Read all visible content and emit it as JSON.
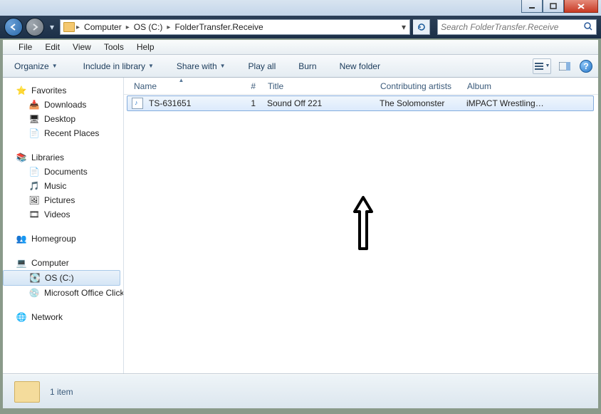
{
  "window": {
    "breadcrumbs": [
      "Computer",
      "OS (C:)",
      "FolderTransfer.Receive"
    ],
    "search_placeholder": "Search FolderTransfer.Receive"
  },
  "menubar": {
    "file": "File",
    "edit": "Edit",
    "view": "View",
    "tools": "Tools",
    "help": "Help"
  },
  "toolbar": {
    "organize": "Organize",
    "include": "Include in library",
    "share": "Share with",
    "playall": "Play all",
    "burn": "Burn",
    "newfolder": "New folder"
  },
  "columns": {
    "name": "Name",
    "num": "#",
    "title": "Title",
    "artists": "Contributing artists",
    "album": "Album"
  },
  "rows": [
    {
      "name": "TS-631651",
      "num": "1",
      "title": "Sound Off 221",
      "artists": "The Solomonster",
      "album": "iMPACT Wrestling G..."
    }
  ],
  "nav": {
    "favorites": "Favorites",
    "downloads": "Downloads",
    "desktop": "Desktop",
    "recent": "Recent Places",
    "libraries": "Libraries",
    "documents": "Documents",
    "music": "Music",
    "pictures": "Pictures",
    "videos": "Videos",
    "homegroup": "Homegroup",
    "computer": "Computer",
    "osc": "OS (C:)",
    "msoffice": "Microsoft Office Click-to-Run",
    "network": "Network"
  },
  "status": {
    "count": "1 item"
  }
}
